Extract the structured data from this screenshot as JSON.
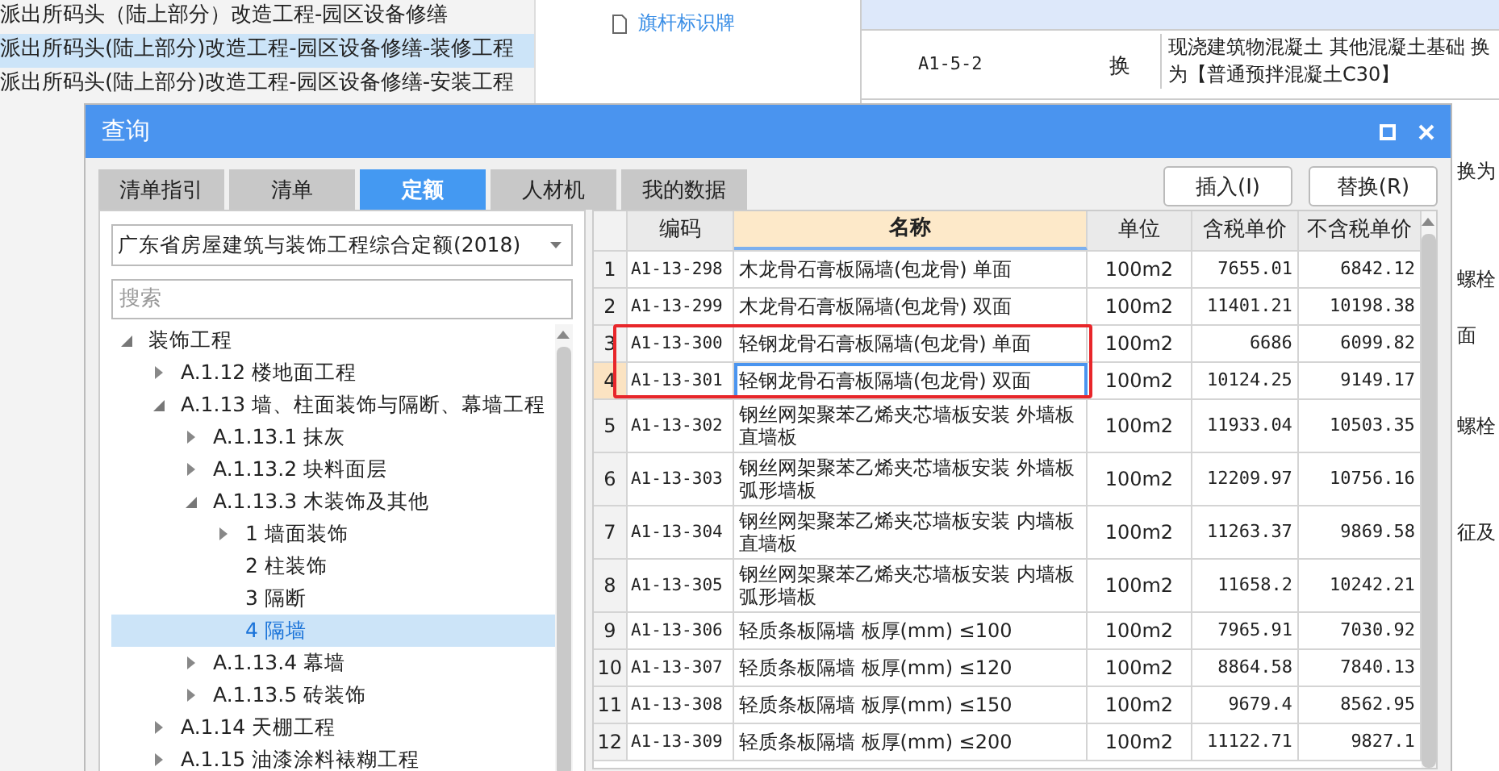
{
  "background": {
    "projects": [
      {
        "label": "派出所码头（陆上部分）改造工程-园区设备修缮",
        "selected": false
      },
      {
        "label": "派出所码头(陆上部分)改造工程-园区设备修缮-装修工程",
        "selected": true
      },
      {
        "label": "派出所码头(陆上部分)改造工程-园区设备修缮-安装工程",
        "selected": false
      }
    ],
    "tree_item": "旗杆标识牌",
    "row": {
      "code": "A1-5-2",
      "mark": "换",
      "name": "现浇建筑物混凝土 其他混凝土基础  换为【普通预拌混凝土C30】"
    },
    "side_fragments": [
      "换为",
      "螺栓",
      "面",
      "螺栓",
      "征及"
    ]
  },
  "dialog": {
    "title": "查询",
    "tabs": [
      {
        "label": "清单指引",
        "selected": false
      },
      {
        "label": "清单",
        "selected": false
      },
      {
        "label": "定额",
        "selected": true
      },
      {
        "label": "人材机",
        "selected": false
      },
      {
        "label": "我的数据",
        "selected": false
      }
    ],
    "buttons": [
      "插入(I)",
      "替换(R)"
    ],
    "library": "广东省房屋建筑与装饰工程综合定额(2018)",
    "search": {
      "placeholder": "搜索"
    },
    "tree": [
      {
        "label": "装饰工程",
        "expanded": true,
        "selected": false,
        "children": [
          {
            "label": "A.1.12  楼地面工程",
            "expanded": false,
            "selected": false
          },
          {
            "label": "A.1.13  墙、柱面装饰与隔断、幕墙工程",
            "expanded": true,
            "selected": false,
            "children": [
              {
                "label": "A.1.13.1  抹灰",
                "expanded": false,
                "selected": false
              },
              {
                "label": "A.1.13.2  块料面层",
                "expanded": false,
                "selected": false
              },
              {
                "label": "A.1.13.3  木装饰及其他",
                "expanded": true,
                "selected": false,
                "children": [
                  {
                    "label": "1  墙面装饰",
                    "expanded": false,
                    "selected": false
                  },
                  {
                    "label": "2  柱装饰",
                    "selected": false
                  },
                  {
                    "label": "3  隔断",
                    "selected": false
                  },
                  {
                    "label": "4  隔墙",
                    "selected": true
                  }
                ]
              },
              {
                "label": "A.1.13.4  幕墙",
                "expanded": false,
                "selected": false
              },
              {
                "label": "A.1.13.5  砖装饰",
                "expanded": false,
                "selected": false
              }
            ]
          },
          {
            "label": "A.1.14  天棚工程",
            "expanded": false,
            "selected": false
          },
          {
            "label": "A.1.15  油漆涂料裱糊工程",
            "expanded": false,
            "selected": false
          }
        ]
      }
    ],
    "table": {
      "columns": [
        "编码",
        "名称",
        "单位",
        "含税单价",
        "不含税单价"
      ],
      "rows": [
        {
          "no": "1",
          "code": "A1-13-298",
          "name": "木龙骨石膏板隔墙(包龙骨) 单面",
          "unit": "100m2",
          "tax": "7655.01",
          "notax": "6842.12",
          "selected": false
        },
        {
          "no": "2",
          "code": "A1-13-299",
          "name": "木龙骨石膏板隔墙(包龙骨) 双面",
          "unit": "100m2",
          "tax": "11401.21",
          "notax": "10198.38",
          "selected": false
        },
        {
          "no": "3",
          "code": "A1-13-300",
          "name": "轻钢龙骨石膏板隔墙(包龙骨) 单面",
          "unit": "100m2",
          "tax": "6686",
          "notax": "6099.82",
          "selected": false,
          "annotated": true
        },
        {
          "no": "4",
          "code": "A1-13-301",
          "name": "轻钢龙骨石膏板隔墙(包龙骨) 双面",
          "unit": "100m2",
          "tax": "10124.25",
          "notax": "9149.17",
          "selected": true,
          "annotated": true
        },
        {
          "no": "5",
          "code": "A1-13-302",
          "name": "钢丝网架聚苯乙烯夹芯墙板安装 外墙板直墙板",
          "unit": "100m2",
          "tax": "11933.04",
          "notax": "10503.35",
          "selected": false
        },
        {
          "no": "6",
          "code": "A1-13-303",
          "name": "钢丝网架聚苯乙烯夹芯墙板安装 外墙板弧形墙板",
          "unit": "100m2",
          "tax": "12209.97",
          "notax": "10756.16",
          "selected": false
        },
        {
          "no": "7",
          "code": "A1-13-304",
          "name": "钢丝网架聚苯乙烯夹芯墙板安装 内墙板直墙板",
          "unit": "100m2",
          "tax": "11263.37",
          "notax": "9869.58",
          "selected": false
        },
        {
          "no": "8",
          "code": "A1-13-305",
          "name": "钢丝网架聚苯乙烯夹芯墙板安装 内墙板弧形墙板",
          "unit": "100m2",
          "tax": "11658.2",
          "notax": "10242.21",
          "selected": false
        },
        {
          "no": "9",
          "code": "A1-13-306",
          "name": "轻质条板隔墙 板厚(mm) ≤100",
          "unit": "100m2",
          "tax": "7965.91",
          "notax": "7030.92",
          "selected": false
        },
        {
          "no": "10",
          "code": "A1-13-307",
          "name": "轻质条板隔墙 板厚(mm) ≤120",
          "unit": "100m2",
          "tax": "8864.58",
          "notax": "7840.13",
          "selected": false
        },
        {
          "no": "11",
          "code": "A1-13-308",
          "name": "轻质条板隔墙 板厚(mm) ≤150",
          "unit": "100m2",
          "tax": "9679.4",
          "notax": "8562.95",
          "selected": false
        },
        {
          "no": "12",
          "code": "A1-13-309",
          "name": "轻质条板隔墙 板厚(mm) ≤200",
          "unit": "100m2",
          "tax": "11122.71",
          "notax": "9827.1",
          "selected": false
        }
      ]
    }
  }
}
